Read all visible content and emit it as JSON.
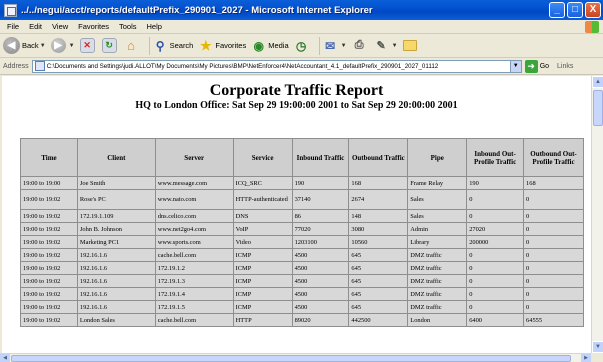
{
  "window": {
    "title": "../../negui/acct/reports/defaultPrefix_290901_2027 - Microsoft Internet Explorer",
    "minimize": "_",
    "maximize": "□",
    "close": "X"
  },
  "menu": [
    "File",
    "Edit",
    "View",
    "Favorites",
    "Tools",
    "Help"
  ],
  "toolbar": {
    "back_label": "Back",
    "search_label": "Search",
    "favorites_label": "Favorites",
    "media_label": "Media"
  },
  "address": {
    "label": "Address",
    "value": "C:\\Documents and Settings\\judi.ALLOT\\My Documents\\My Pictures\\BMP\\NetEnforcer4\\NetAccountant_4.1_defaultPrefix_290901_2027_01112",
    "go_label": "Go",
    "links_label": "Links"
  },
  "report": {
    "title": "Corporate Traffic Report",
    "subtitle": "HQ to London Office: Sat Sep 29 19:00:00 2001 to Sat Sep 29 20:00:00 2001",
    "columns": [
      "Time",
      "Client",
      "Server",
      "Service",
      "Inbound Traffic",
      "Outbound Traffic",
      "Pipe",
      "Inbound Out-Profile Traffic",
      "Outbound Out-Profile Traffic"
    ],
    "rows": [
      [
        "19:00 to 19:00",
        "Joe Smith",
        "www.message.com",
        "ICQ_SRC",
        "190",
        "168",
        "Frame Relay",
        "190",
        "168"
      ],
      [
        "19:00 to 19:02",
        "Rose's PC",
        "www.nato.com",
        "HTTP-authenticated",
        "37140",
        "2674",
        "Sales",
        "0",
        "0"
      ],
      [
        "19:00 to 19:02",
        "172.19.1.109",
        "dns.celico.com",
        "DNS",
        "86",
        "148",
        "Sales",
        "0",
        "0"
      ],
      [
        "19:00 to 19:02",
        "John B. Johnson",
        "www.net2go4.com",
        "VoIP",
        "77020",
        "3080",
        "Admin",
        "27020",
        "0"
      ],
      [
        "19:00 to 19:02",
        "Marketing PC1",
        "www.sports.com",
        "Video",
        "1203100",
        "10560",
        "Library",
        "200000",
        "0"
      ],
      [
        "19:00 to 19:02",
        "192.16.1.6",
        "cache.bell.com",
        "ICMP",
        "4500",
        "645",
        "DMZ traffic",
        "0",
        "0"
      ],
      [
        "19:00 to 19:02",
        "192.16.1.6",
        "172.19.1.2",
        "ICMP",
        "4500",
        "645",
        "DMZ traffic",
        "0",
        "0"
      ],
      [
        "19:00 to 19:02",
        "192.16.1.6",
        "172.19.1.3",
        "ICMP",
        "4500",
        "645",
        "DMZ traffic",
        "0",
        "0"
      ],
      [
        "19:00 to 19:02",
        "192.16.1.6",
        "172.19.1.4",
        "ICMP",
        "4500",
        "645",
        "DMZ traffic",
        "0",
        "0"
      ],
      [
        "19:00 to 19:02",
        "192.16.1.6",
        "172.19.1.5",
        "ICMP",
        "4500",
        "645",
        "DMZ traffic",
        "0",
        "0"
      ],
      [
        "19:00 to 19:02",
        "London Sales",
        "cache.bell.com",
        "HTTP",
        "89020",
        "442500",
        "London",
        "6400",
        "64555"
      ]
    ]
  }
}
